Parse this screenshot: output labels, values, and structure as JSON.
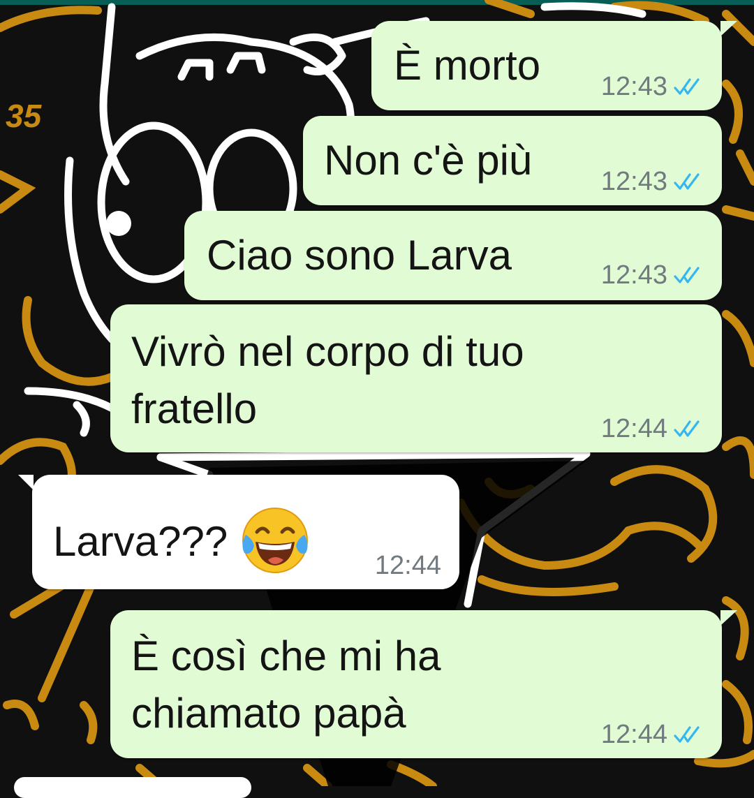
{
  "colors": {
    "outgoing_bubble": "#e1fbd4",
    "incoming_bubble": "#ffffff",
    "wallpaper_bg": "#101010",
    "wallpaper_gold": "#c98a12",
    "wallpaper_white": "#ffffff",
    "read_ticks": "#34b7f1",
    "top_bar": "#075e54",
    "timestamp": "#707a80"
  },
  "messages": [
    {
      "direction": "out",
      "text": "È morto",
      "time": "12:43",
      "status": "read-ticks-icon"
    },
    {
      "direction": "out",
      "text": "Non c'è più",
      "time": "12:43",
      "status": "read-ticks-icon"
    },
    {
      "direction": "out",
      "text": "Ciao sono Larva",
      "time": "12:43",
      "status": "read-ticks-icon"
    },
    {
      "direction": "out",
      "line1": "Vivrò nel corpo di tuo",
      "line2": "fratello",
      "time": "12:44",
      "status": "read-ticks-icon"
    },
    {
      "direction": "in",
      "text": "Larva???",
      "emoji": "face-with-tears-of-joy-icon",
      "time": "12:44"
    },
    {
      "direction": "out",
      "line1": "È così che mi ha",
      "line2": "chiamato papà",
      "time": "12:44",
      "status": "read-ticks-icon"
    }
  ]
}
